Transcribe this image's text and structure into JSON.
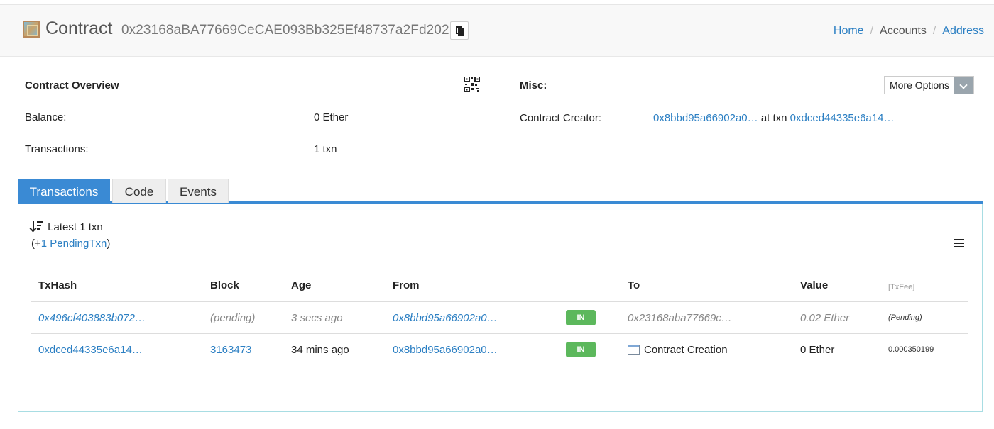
{
  "header": {
    "title": "Contract",
    "address": "0x23168aBA77669CeCAE093Bb325Ef48737a2Fd202",
    "breadcrumb": [
      "Home",
      "Accounts",
      "Address"
    ]
  },
  "overview": {
    "heading": "Contract Overview",
    "balance_label": "Balance:",
    "balance_value": "0 Ether",
    "transactions_label": "Transactions:",
    "transactions_value": "1 txn"
  },
  "misc": {
    "heading": "Misc:",
    "more_options_label": "More Options",
    "creator_label": "Contract Creator:",
    "creator_address": "0x8bbd95a66902a0…",
    "at_txn_text": "at txn",
    "creator_txn": "0xdced44335e6a14…"
  },
  "tabs": [
    "Transactions",
    "Code",
    "Events"
  ],
  "txlist": {
    "latest_text": "Latest 1 txn",
    "pending_prefix": "(+",
    "pending_link": "1 PendingTxn",
    "pending_suffix": ")",
    "columns": [
      "TxHash",
      "Block",
      "Age",
      "From",
      "",
      "To",
      "Value",
      "[TxFee]"
    ],
    "rows": [
      {
        "txhash": "0x496cf403883b072…",
        "block": "(pending)",
        "age": "3 secs ago",
        "from": "0x8bbd95a66902a0…",
        "direction": "IN",
        "to": "0x23168aba77669c…",
        "value": "0.02 Ether",
        "fee": "(Pending)"
      },
      {
        "txhash": "0xdced44335e6a14…",
        "block": "3163473",
        "age": "34 mins ago",
        "from": "0x8bbd95a66902a0…",
        "direction": "IN",
        "to": "Contract Creation",
        "value": "0 Ether",
        "fee": "0.000350199"
      }
    ]
  },
  "colors": {
    "accent": "#3a8ad4",
    "link": "#2b7fc3",
    "badge_in": "#5cb85c"
  }
}
